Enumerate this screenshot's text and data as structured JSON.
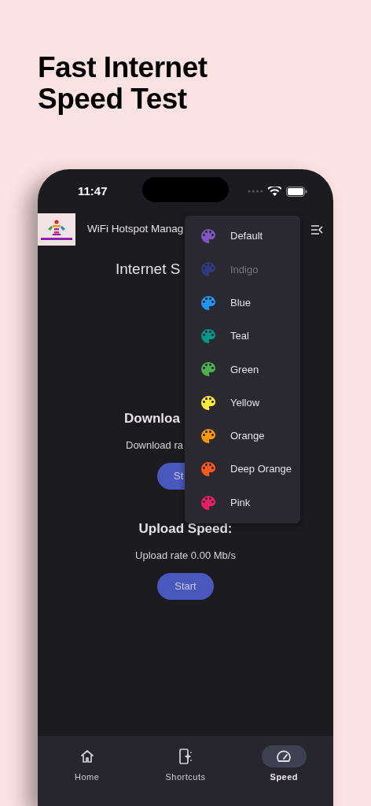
{
  "headline": [
    "Fast Internet",
    "Speed Test"
  ],
  "status_bar": {
    "time": "11:47"
  },
  "app_bar": {
    "title": "WiFi Hotspot Manag"
  },
  "content": {
    "heading": "Internet S",
    "sections": [
      {
        "kind": "covered",
        "title": "Downloa",
        "rate": "Download ra",
        "button": "St"
      },
      {
        "kind": "plain",
        "title": "Upload Speed:",
        "rate": "Upload rate 0.00 Mb/s",
        "button": "Start"
      }
    ]
  },
  "theme_menu": {
    "items": [
      {
        "label": "Default",
        "color": "#7e57c2",
        "disabled": false
      },
      {
        "label": "Indigo",
        "color": "#2f3a80",
        "disabled": true
      },
      {
        "label": "Blue",
        "color": "#2196f3",
        "disabled": false
      },
      {
        "label": "Teal",
        "color": "#009688",
        "disabled": false
      },
      {
        "label": "Green",
        "color": "#4caf50",
        "disabled": false
      },
      {
        "label": "Yellow",
        "color": "#ffeb3b",
        "disabled": false
      },
      {
        "label": "Orange",
        "color": "#ff9800",
        "disabled": false
      },
      {
        "label": "Deep Orange",
        "color": "#ff5722",
        "disabled": false
      },
      {
        "label": "Pink",
        "color": "#e91e63",
        "disabled": false
      }
    ]
  },
  "bottom_nav": [
    {
      "label": "Home",
      "selected": false
    },
    {
      "label": "Shortcuts",
      "selected": false
    },
    {
      "label": "Speed",
      "selected": true
    }
  ]
}
